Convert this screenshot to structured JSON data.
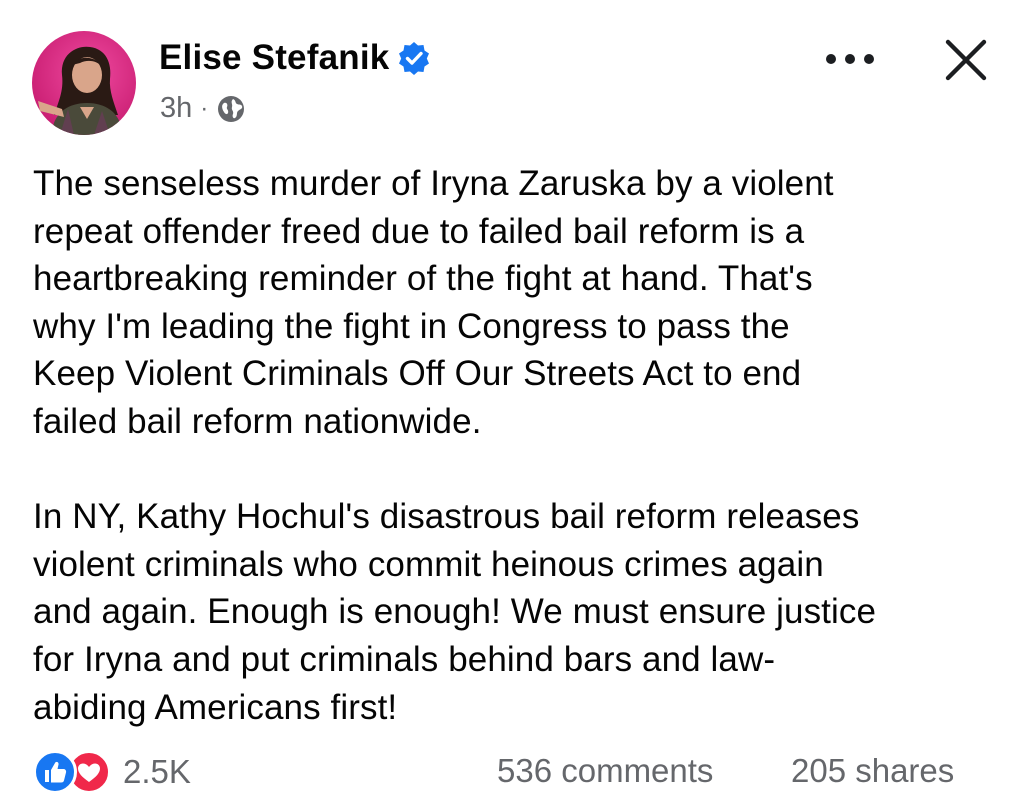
{
  "post": {
    "author": "Elise Stefanik",
    "verified": true,
    "timestamp": "3h",
    "separator": "·",
    "audience_icon": "globe-icon",
    "paragraphs": [
      "The senseless murder of Iryna Zaruska by a violent\nrepeat offender freed due to failed bail reform is a\nheartbreaking reminder of the fight at hand. That's\nwhy I'm leading the fight in Congress to pass the\nKeep Violent Criminals Off Our Streets Act to end\nfailed bail reform nationwide.",
      "In NY, Kathy Hochul's disastrous bail reform releases\nviolent criminals who commit heinous crimes again\nand again. Enough is enough! We must ensure justice\nfor Iryna and put criminals behind bars and law-\nabiding Americans first!"
    ]
  },
  "engagement": {
    "reaction_icons": [
      "like-icon",
      "love-icon"
    ],
    "reactions": "2.5K",
    "comments": "536 comments",
    "shares": "205 shares"
  },
  "header_icons": [
    "more-options-icon",
    "close-icon"
  ],
  "colors": {
    "text": "#050505",
    "secondary_text": "#65676b",
    "verified_blue": "#1877f2",
    "like_blue": "#1877f2",
    "love_red": "#f0284a",
    "avatar_background": "#e3267f"
  }
}
